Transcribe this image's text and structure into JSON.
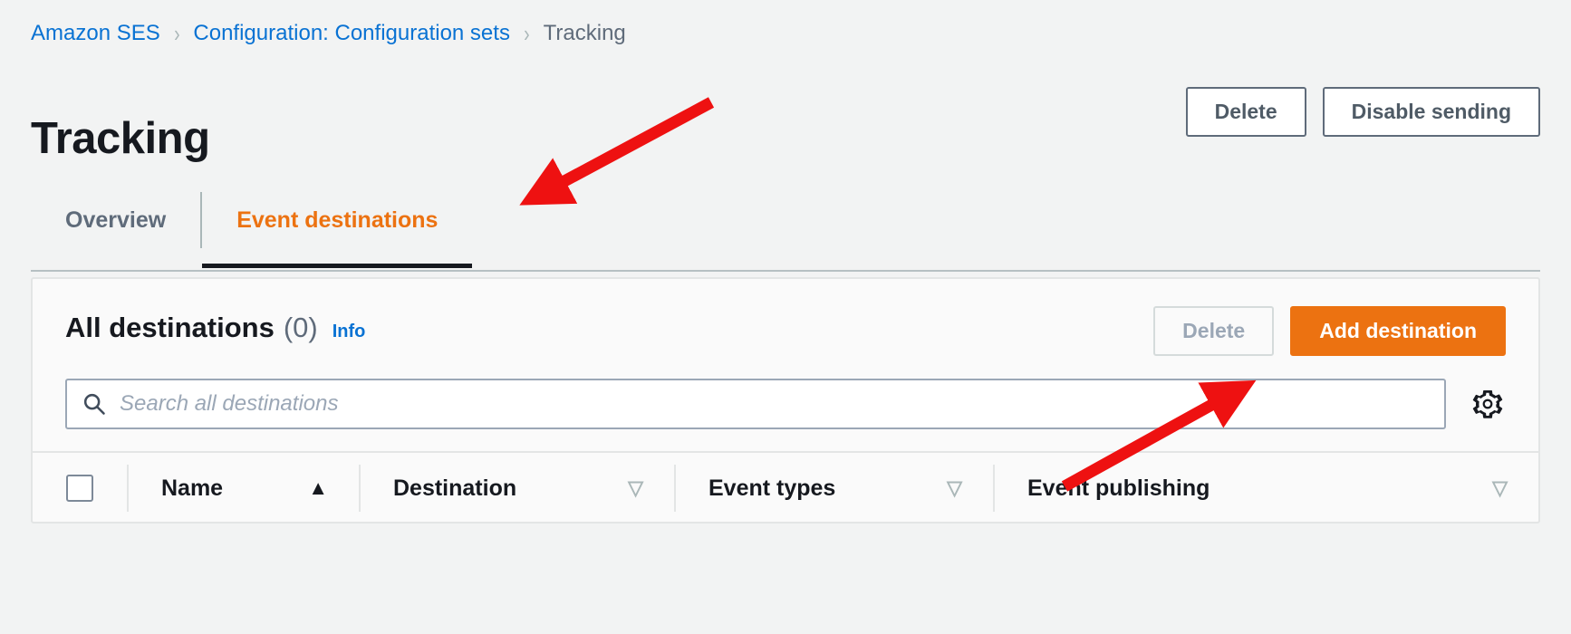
{
  "breadcrumb": {
    "items": [
      {
        "label": "Amazon SES",
        "type": "link"
      },
      {
        "label": "Configuration: Configuration sets",
        "type": "link"
      },
      {
        "label": "Tracking",
        "type": "current"
      }
    ],
    "separator": "›"
  },
  "header": {
    "title": "Tracking",
    "actions": [
      {
        "label": "Delete",
        "variant": "normal"
      },
      {
        "label": "Disable sending",
        "variant": "normal"
      }
    ]
  },
  "tabs": [
    {
      "label": "Overview",
      "active": false
    },
    {
      "label": "Event destinations",
      "active": true
    }
  ],
  "card": {
    "title": "All destinations",
    "count": "(0)",
    "info_label": "Info",
    "actions": [
      {
        "label": "Delete",
        "variant": "disabled"
      },
      {
        "label": "Add destination",
        "variant": "primary"
      }
    ],
    "search": {
      "placeholder": "Search all destinations",
      "value": "",
      "icon": "search-icon"
    },
    "settings_icon": "gear-icon",
    "table": {
      "select_all": {
        "checked": false,
        "icon": "checkbox-icon"
      },
      "columns": [
        {
          "label": "Name",
          "sort": "ascending",
          "sort_icon": "▲"
        },
        {
          "label": "Destination",
          "sort": "none",
          "sort_icon": "▽"
        },
        {
          "label": "Event types",
          "sort": "none",
          "sort_icon": "▽"
        },
        {
          "label": "Event publishing",
          "sort": "none",
          "sort_icon": "▽"
        }
      ],
      "rows": []
    }
  },
  "colors": {
    "page_background": "#f2f3f3",
    "link": "#0972d3",
    "accent_orange": "#ec7211",
    "text_primary": "#16191f",
    "text_secondary": "#5f6b7a",
    "border": "#e3e5e5",
    "annotation_arrow": "#ee1111"
  },
  "annotations": [
    {
      "name": "arrow-to-event-destinations-tab",
      "color": "#ee1111"
    },
    {
      "name": "arrow-to-add-destination-button",
      "color": "#ee1111"
    }
  ]
}
